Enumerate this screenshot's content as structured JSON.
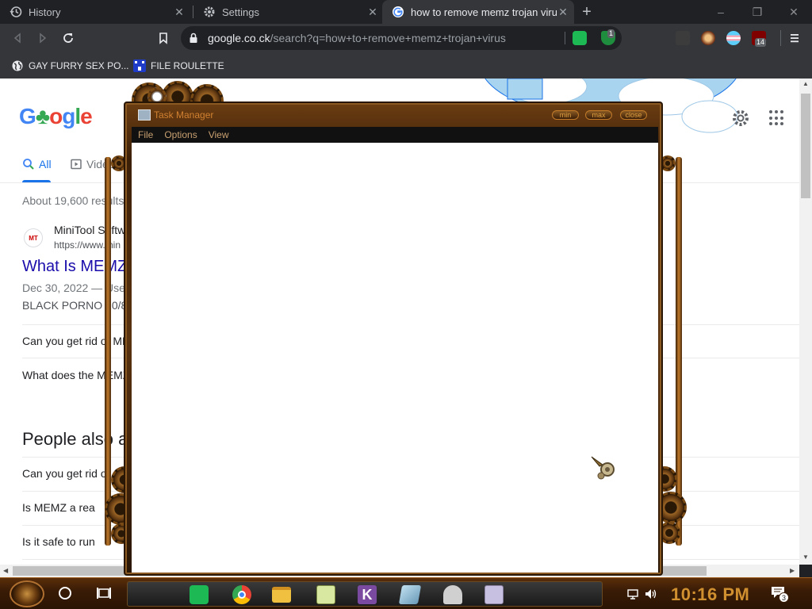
{
  "browser": {
    "tabs": [
      {
        "label": "History",
        "icon": "history-icon",
        "active": false
      },
      {
        "label": "Settings",
        "icon": "gear-icon",
        "active": false
      },
      {
        "label": "how to remove memz trojan virus",
        "icon": "google-icon",
        "active": true
      }
    ],
    "new_tab": "+",
    "window_controls": {
      "minimize": "–",
      "restore": "❐",
      "close": "✕"
    },
    "address": {
      "host": "google.co.ck",
      "path": "/search?q=how+to+remove+memz+trojan+virus"
    },
    "extension_badges": {
      "ublock": "14",
      "shield": "1"
    },
    "bookmarks": [
      {
        "label": "GAY FURRY SEX PO...",
        "icon": "globe-icon"
      },
      {
        "label": "FILE ROULETTE",
        "icon": "file-roulette-icon"
      }
    ]
  },
  "google": {
    "logo": "Google",
    "tabs": [
      {
        "label": "All"
      },
      {
        "label": "Video"
      }
    ],
    "result_stats": "About 19,600 results",
    "result": {
      "favicon": "MT",
      "site_name": "MiniTool Softw",
      "site_url": "https://www.min",
      "title": "What Is MEMZ",
      "date": "Dec 30, 2022 — Use",
      "snippet": "BLACK PORNO 10/8"
    },
    "questions_top": [
      "Can you get rid of ME",
      "What does the MEMZ"
    ],
    "people_also_ask": "People also a",
    "questions_bottom": [
      "Can you get rid of",
      "Is MEMZ a rea",
      "Is it safe to run"
    ]
  },
  "task_manager": {
    "title": "Task Manager",
    "menu": [
      "File",
      "Options",
      "View"
    ],
    "controls": [
      "min",
      "max",
      "close"
    ]
  },
  "taskbar": {
    "clock": "10:16 PM",
    "notification_count": "3",
    "apps": [
      "spotify-icon",
      "chrome-icon",
      "folder-icon",
      "notepad-icon",
      "k-app-icon",
      "paper-icon",
      "people-icon",
      "screenshot-icon"
    ]
  },
  "colors": {
    "chrome_dark": "#202124",
    "chrome_toolbar": "#35363a",
    "link_blue": "#1a0dab",
    "accent_blue": "#1a73e8",
    "steampunk_bronze": "#c07a2a",
    "clock_gold": "#d09030"
  }
}
